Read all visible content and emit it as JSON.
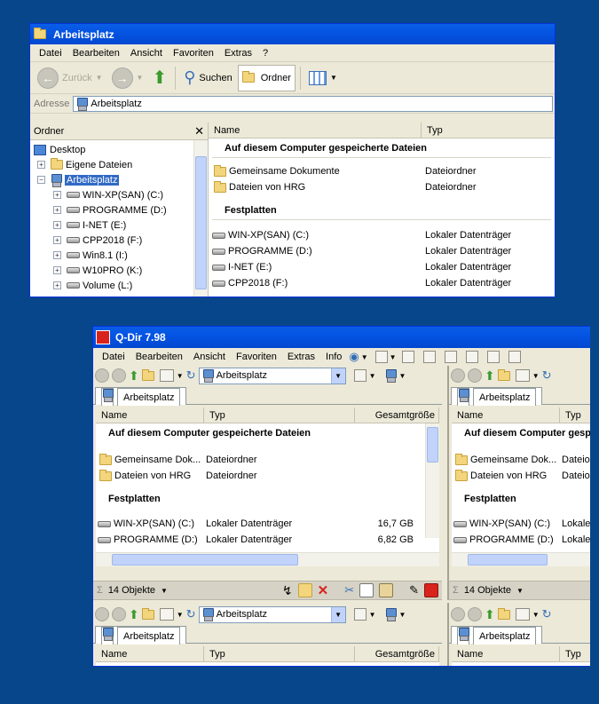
{
  "explorer": {
    "title": "Arbeitsplatz",
    "menu": [
      "Datei",
      "Bearbeiten",
      "Ansicht",
      "Favoriten",
      "Extras",
      "?"
    ],
    "toolbar": {
      "back": "Zurück",
      "search": "Suchen",
      "folders": "Ordner"
    },
    "address": {
      "label": "Adresse",
      "value": "Arbeitsplatz"
    },
    "tree": {
      "title": "Ordner",
      "items": [
        "Desktop",
        "Eigene Dateien",
        "Arbeitsplatz",
        "WIN-XP(SAN) (C:)",
        "PROGRAMME (D:)",
        "I-NET (E:)",
        "CPP2018 (F:)",
        "Win8.1 (I:)",
        "W10PRO (K:)",
        "Volume (L:)"
      ]
    },
    "columns": [
      "Name",
      "Typ"
    ],
    "group_files": "Auf diesem Computer gespeicherte Dateien",
    "folders": [
      {
        "name": "Gemeinsame Dokumente",
        "type": "Dateiordner"
      },
      {
        "name": "Dateien von HRG",
        "type": "Dateiordner"
      }
    ],
    "group_drives": "Festplatten",
    "drives": [
      {
        "name": "WIN-XP(SAN) (C:)",
        "type": "Lokaler Datenträger"
      },
      {
        "name": "PROGRAMME (D:)",
        "type": "Lokaler Datenträger"
      },
      {
        "name": "I-NET (E:)",
        "type": "Lokaler Datenträger"
      },
      {
        "name": "CPP2018 (F:)",
        "type": "Lokaler Datenträger"
      }
    ]
  },
  "qdir": {
    "title": "Q-Dir 7.98",
    "menu": [
      "Datei",
      "Bearbeiten",
      "Ansicht",
      "Favoriten",
      "Extras",
      "Info"
    ],
    "address": "Arbeitsplatz",
    "tab": "Arbeitsplatz",
    "columns": [
      "Name",
      "Typ",
      "Gesamtgröße"
    ],
    "group_files": "Auf diesem Computer gespeicherte Dateien",
    "folders": [
      {
        "name": "Gemeinsame Dok...",
        "type": "Dateiordner"
      },
      {
        "name": "Dateien von HRG",
        "type": "Dateiordner"
      }
    ],
    "folders_right": [
      {
        "name": "Gemeinsame Dok...",
        "type": "Dateio"
      },
      {
        "name": "Dateien von HRG",
        "type": "Dateio"
      }
    ],
    "group_drives": "Festplatten",
    "drives": [
      {
        "name": "WIN-XP(SAN) (C:)",
        "type": "Lokaler Datenträger",
        "size": "16,7 GB"
      },
      {
        "name": "PROGRAMME (D:)",
        "type": "Lokaler Datenträger",
        "size": "6,82 GB"
      }
    ],
    "drives_right": [
      {
        "name": "WIN-XP(SAN) (C:)",
        "type": "Lokale"
      },
      {
        "name": "PROGRAMME (D:)",
        "type": "Lokale"
      }
    ],
    "group_files_right": "Auf diesem Computer gespeicherte Dateien",
    "status": "14 Objekte",
    "col_right": [
      "Name",
      "Typ"
    ]
  }
}
